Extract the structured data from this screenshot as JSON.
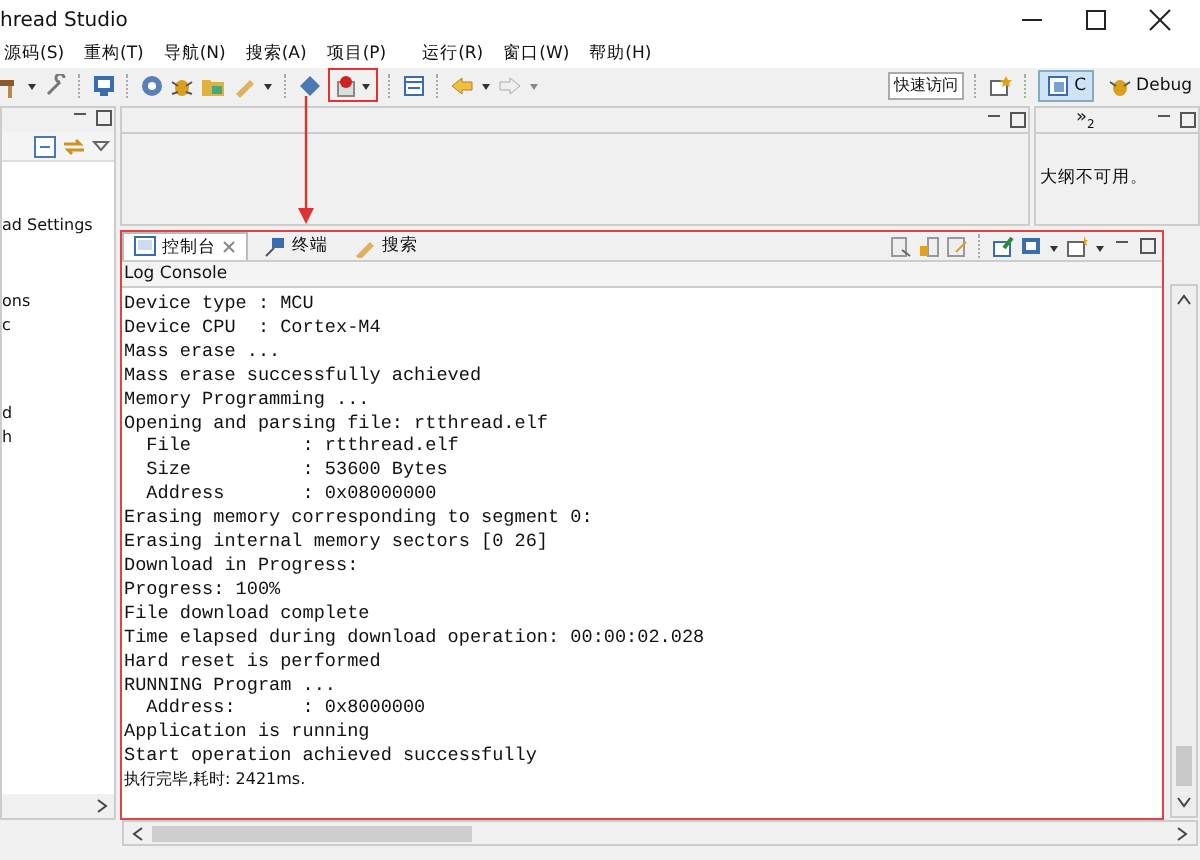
{
  "window": {
    "title": "hread Studio"
  },
  "menu": [
    "源码(S)",
    "重构(T)",
    "导航(N)",
    "搜索(A)",
    "项目(P)",
    "运行(R)",
    "窗口(W)",
    "帮助(H)"
  ],
  "toolbar": {
    "quick_access": "快速访问",
    "perspectives": [
      {
        "label": "C",
        "selected": true
      },
      {
        "label": "Debug",
        "selected": false
      }
    ]
  },
  "left_panel": {
    "items": [
      "ad Settings",
      "ons",
      "c",
      "d",
      "h"
    ]
  },
  "outline": {
    "overflow": "»",
    "overflow_count": "2",
    "message": "大纲不可用。"
  },
  "console": {
    "tabs": [
      {
        "label": "控制台",
        "selected": true
      },
      {
        "label": "终端",
        "selected": false
      },
      {
        "label": "搜索",
        "selected": false
      }
    ],
    "title": "Log Console",
    "lines": [
      {
        "text": "Device type : MCU",
        "kind": "mono"
      },
      {
        "text": "Device CPU  : Cortex-M4",
        "kind": "mono"
      },
      {
        "text": "Mass erase ...",
        "kind": "mono"
      },
      {
        "text": "Mass erase successfully achieved",
        "kind": "mono"
      },
      {
        "text": "Memory Programming ...",
        "kind": "mono"
      },
      {
        "text": "Opening and parsing file: rtthread.elf",
        "kind": "mono"
      },
      {
        "text": "  File          : rtthread.elf",
        "kind": "mono"
      },
      {
        "text": "  Size          : 53600 Bytes",
        "kind": "mono"
      },
      {
        "text": "  Address       : 0x08000000",
        "kind": "mono"
      },
      {
        "text": "Erasing memory corresponding to segment 0:",
        "kind": "mono"
      },
      {
        "text": "Erasing internal memory sectors [0 26]",
        "kind": "mono"
      },
      {
        "text": "Download in Progress:",
        "kind": "mono"
      },
      {
        "text": "Progress: 100%",
        "kind": "mono"
      },
      {
        "text": "File download complete",
        "kind": "mono"
      },
      {
        "text": "Time elapsed during download operation: 00:00:02.028",
        "kind": "mono"
      },
      {
        "text": "Hard reset is performed",
        "kind": "mono"
      },
      {
        "text": "RUNNING Program ...",
        "kind": "mono"
      },
      {
        "text": "  Address:      : 0x8000000",
        "kind": "mono"
      },
      {
        "text": "Application is running",
        "kind": "mono"
      },
      {
        "text": "Start operation achieved successfully",
        "kind": "mono"
      },
      {
        "text": "执行完毕,耗时: 2421ms.",
        "kind": "status"
      }
    ]
  }
}
